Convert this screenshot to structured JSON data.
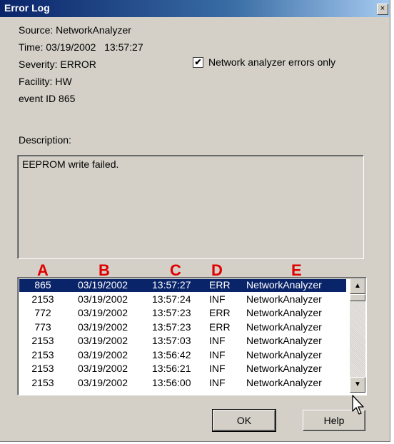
{
  "window": {
    "title": "Error Log",
    "close_glyph": "×"
  },
  "info": {
    "source": "Source: NetworkAnalyzer",
    "time": "Time: 03/19/2002   13:57:27",
    "severity": "Severity: ERROR",
    "facility": "Facility: HW",
    "event_id": "event ID 865",
    "description_label": "Description:"
  },
  "filter": {
    "checked": true,
    "check_glyph": "✔",
    "label": "Network analyzer errors only"
  },
  "description": {
    "text": "EEPROM write failed."
  },
  "annotations": {
    "a": "A",
    "b": "B",
    "c": "C",
    "d": "D",
    "e": "E",
    "color": "#e00000"
  },
  "log": {
    "selected_index": 0,
    "rows": [
      {
        "id": "865",
        "date": "03/19/2002",
        "time": "13:57:27",
        "sev": "ERR",
        "src": "NetworkAnalyzer"
      },
      {
        "id": "2153",
        "date": "03/19/2002",
        "time": "13:57:24",
        "sev": "INF",
        "src": "NetworkAnalyzer"
      },
      {
        "id": "772",
        "date": "03/19/2002",
        "time": "13:57:23",
        "sev": "ERR",
        "src": "NetworkAnalyzer"
      },
      {
        "id": "773",
        "date": "03/19/2002",
        "time": "13:57:23",
        "sev": "ERR",
        "src": "NetworkAnalyzer"
      },
      {
        "id": "2153",
        "date": "03/19/2002",
        "time": "13:57:03",
        "sev": "INF",
        "src": "NetworkAnalyzer"
      },
      {
        "id": "2153",
        "date": "03/19/2002",
        "time": "13:56:42",
        "sev": "INF",
        "src": "NetworkAnalyzer"
      },
      {
        "id": "2153",
        "date": "03/19/2002",
        "time": "13:56:21",
        "sev": "INF",
        "src": "NetworkAnalyzer"
      },
      {
        "id": "2153",
        "date": "03/19/2002",
        "time": "13:56:00",
        "sev": "INF",
        "src": "NetworkAnalyzer"
      }
    ]
  },
  "scrollbar": {
    "up_glyph": "▲",
    "down_glyph": "▼"
  },
  "buttons": {
    "ok": "OK",
    "help": "Help"
  },
  "colors": {
    "selection": "#0a246a",
    "titlebar": "#0a246a",
    "face": "#d4d0c8"
  }
}
